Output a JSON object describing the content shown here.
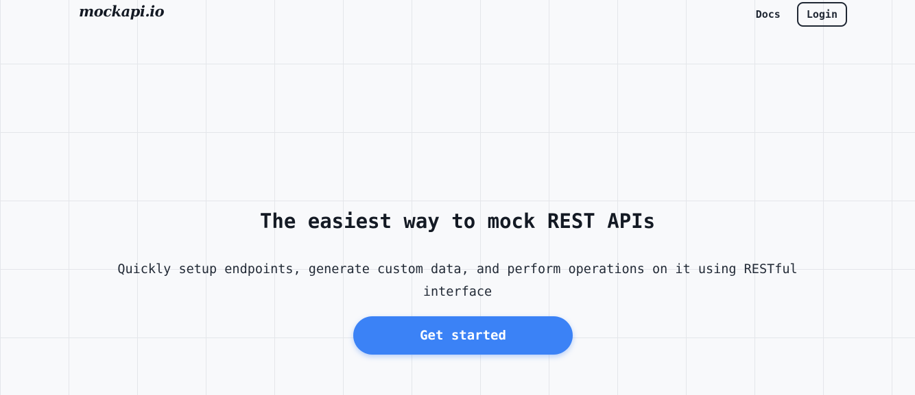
{
  "header": {
    "logo_text": "mockapi.io",
    "nav": {
      "docs_label": "Docs",
      "login_label": "Login"
    }
  },
  "hero": {
    "title": "The easiest way to mock REST APIs",
    "subtitle": "Quickly setup endpoints, generate custom data, and perform operations on it using RESTful interface",
    "cta_label": "Get started"
  },
  "colors": {
    "accent": "#3b82f6",
    "text": "#141a24",
    "background": "#f8f9fb",
    "grid_line": "#e4e6ea"
  }
}
